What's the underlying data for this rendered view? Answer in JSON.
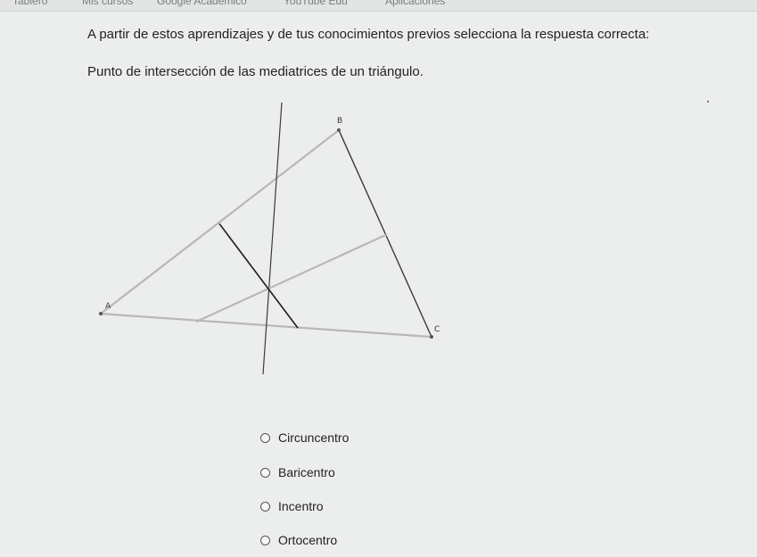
{
  "bookmarks": [
    "Tablero",
    "Mis cursos",
    "Google Académico",
    "YouTube Edu",
    "Aplicaciones"
  ],
  "question": {
    "instruction": "A partir de estos aprendizajes y de tus conocimientos previos selecciona la respuesta correcta:",
    "prompt": "Punto de intersección de las mediatrices de un triángulo."
  },
  "diagram": {
    "vertices": [
      {
        "label": "A"
      },
      {
        "label": "B"
      },
      {
        "label": "C"
      }
    ]
  },
  "options": [
    {
      "label": "Circuncentro",
      "selected": false
    },
    {
      "label": "Baricentro",
      "selected": false
    },
    {
      "label": "Incentro",
      "selected": false
    },
    {
      "label": "Ortocentro",
      "selected": false
    }
  ]
}
